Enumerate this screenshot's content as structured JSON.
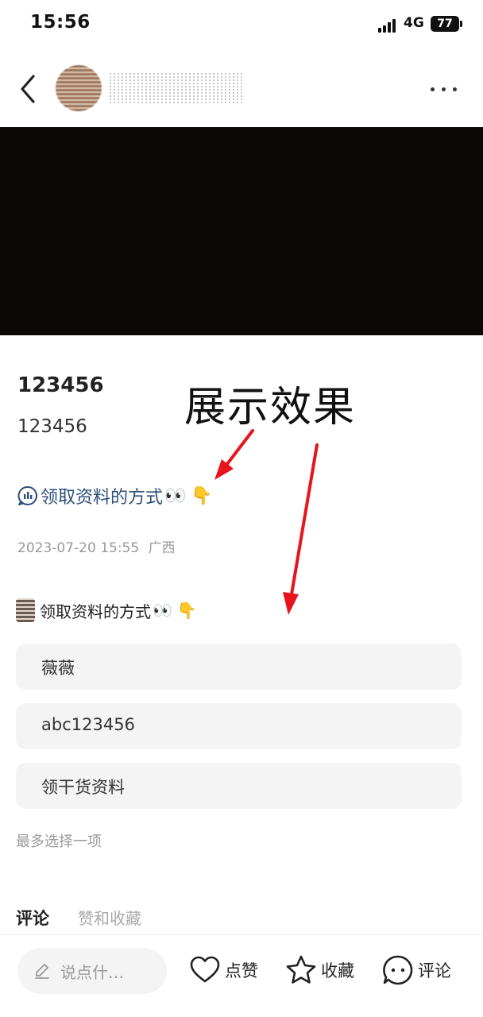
{
  "status_bar": {
    "time": "15:56",
    "network": "4G",
    "battery": "77"
  },
  "post": {
    "title": "123456",
    "body": "123456",
    "topic": "领取资料的方式",
    "topic_emoji_eyes": "👀",
    "topic_emoji_point": "👇",
    "date": "2023-07-20 15:55",
    "location": "广西"
  },
  "overlay_label": "展示效果",
  "vote": {
    "title": "领取资料的方式",
    "title_emoji_eyes": "👀",
    "title_emoji_point": "👇",
    "options": [
      "薇薇",
      "abc123456",
      "领干货资料"
    ],
    "hint": "最多选择一项"
  },
  "tabs": {
    "comments": "评论",
    "likes_favs": "赞和收藏"
  },
  "bottom_bar": {
    "input_placeholder": "说点什…",
    "like": "点赞",
    "favorite": "收藏",
    "comment": "评论"
  },
  "colors": {
    "topic_link": "#2e4f7a",
    "annotation_arrow": "#e8141c",
    "video_bg": "#0b0808"
  }
}
